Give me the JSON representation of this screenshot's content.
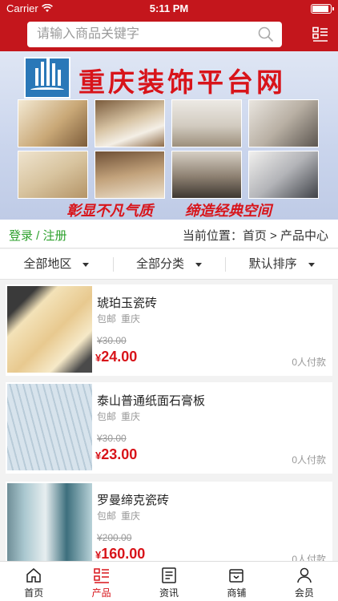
{
  "status": {
    "carrier": "Carrier",
    "time": "5:11 PM"
  },
  "search": {
    "placeholder": "请输入商品关键字"
  },
  "banner": {
    "title": "重庆装饰平台网",
    "slogan_left": "彰显不凡气质",
    "slogan_right": "缔造经典空间"
  },
  "location": {
    "login_label": "登录 / 注册",
    "breadcrumb": "当前位置：首页 > 产品中心"
  },
  "filters": [
    {
      "label": "全部地区"
    },
    {
      "label": "全部分类"
    },
    {
      "label": "默认排序"
    }
  ],
  "products": [
    {
      "name": "琥珀玉瓷砖",
      "shipping": "包邮",
      "city": "重庆",
      "old_price": "¥30.00",
      "currency": "¥",
      "price": "24.00",
      "sold": "0人付款"
    },
    {
      "name": "泰山普通纸面石膏板",
      "shipping": "包邮",
      "city": "重庆",
      "old_price": "¥30.00",
      "currency": "¥",
      "price": "23.00",
      "sold": "0人付款"
    },
    {
      "name": "罗曼缔克瓷砖",
      "shipping": "包邮",
      "city": "重庆",
      "old_price": "¥200.00",
      "currency": "¥",
      "price": "160.00",
      "sold": "0人付款"
    }
  ],
  "tabs": [
    {
      "label": "首页",
      "icon": "home-icon"
    },
    {
      "label": "产品",
      "icon": "list-icon"
    },
    {
      "label": "资讯",
      "icon": "news-icon"
    },
    {
      "label": "商铺",
      "icon": "store-icon"
    },
    {
      "label": "会员",
      "icon": "user-icon"
    }
  ],
  "colors": {
    "brand": "#c4161c",
    "price": "#d8141a",
    "login": "#2ea12e"
  }
}
